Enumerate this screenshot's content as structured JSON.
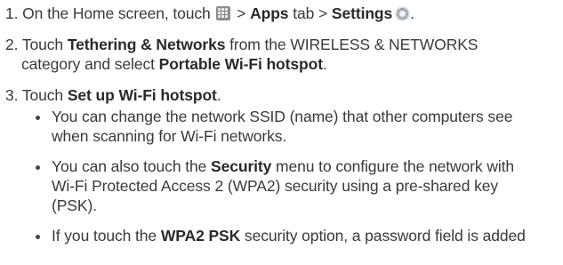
{
  "steps": {
    "s1": {
      "num": "1.",
      "a": "On the Home screen, touch",
      "b": ">",
      "apps_tab": "Apps",
      "c": "tab >",
      "settings": "Settings",
      "d": "."
    },
    "s2": {
      "num": "2.",
      "a": "Touch",
      "tethering": "Tethering & Networks",
      "b": "from the WIRELESS & NETWORKS",
      "c": "category and select",
      "hotspot": "Portable Wi-Fi hotspot",
      "d": "."
    },
    "s3": {
      "num": "3.",
      "a": "Touch",
      "setup": "Set up Wi-Fi hotspot",
      "b": "."
    }
  },
  "bullets": {
    "b1": {
      "l1": "You can change the network SSID (name) that other computers see",
      "l2": "when scanning for Wi-Fi networks."
    },
    "b2": {
      "l1a": "You can also touch the",
      "security": "Security",
      "l1b": "menu to configure the network with",
      "l2": "Wi-Fi Protected Access 2 (WPA2) security using a pre-shared key",
      "l3": "(PSK)."
    },
    "b3": {
      "l1a": "If you touch the",
      "wpa2": "WPA2 PSK",
      "l1b": "security option, a password field is added"
    }
  },
  "icons": {
    "apps": "apps-grid-icon",
    "settings": "settings-gear-icon"
  }
}
